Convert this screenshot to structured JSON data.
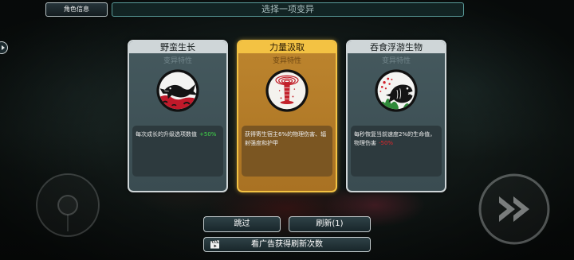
{
  "header": {
    "character_info_label": "角色信息",
    "title": "选择一项变异"
  },
  "cards": [
    {
      "title": "野蛮生长",
      "subtitle": "变异特性",
      "icon": "feral-fish-icon",
      "description": "每次成长的升级选项数值",
      "highlight": "+50%",
      "highlight_color": "#41d94a",
      "selected": false
    },
    {
      "title": "力量汲取",
      "subtitle": "变异特性",
      "icon": "red-vortex-icon",
      "description": "获得寄生宿主6%的物理伤害、辐射强度和护甲",
      "selected": true
    },
    {
      "title": "吞食浮游生物",
      "subtitle": "变异特性",
      "icon": "plankton-fish-icon",
      "description": "每秒恢复当前速度2%的生命值，物理伤害",
      "highlight": "-50%",
      "highlight_color": "#e0262b",
      "selected": false
    }
  ],
  "buttons": {
    "skip_label": "跳过",
    "refresh_label": "刷新(1)",
    "watch_ad_label": "看广告获得刷新次数",
    "watch_ad_icon": "clapperboard-icon"
  },
  "controls": {
    "joystick_icon": "joystick-icon",
    "fast_forward_icon": "fast-forward-icon",
    "side_menu_icon": "side-menu-icon"
  },
  "colors": {
    "card_accent": "#cfd6d8",
    "selected_card_accent": "#f3c243",
    "title_bar_border": "#5a9c9a"
  }
}
